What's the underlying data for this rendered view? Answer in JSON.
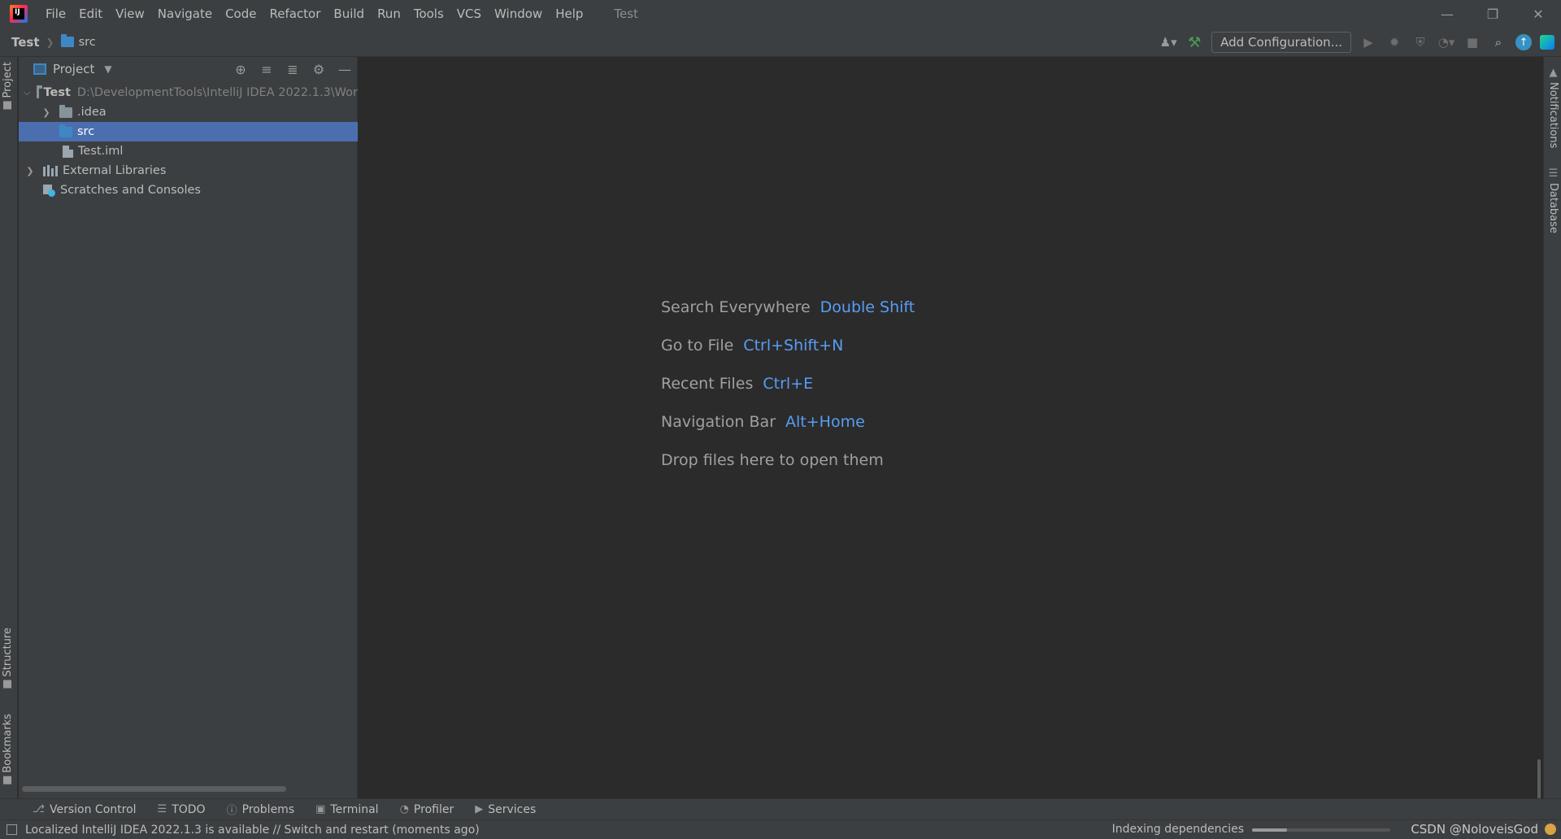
{
  "menu": {
    "items": [
      {
        "label": "File"
      },
      {
        "label": "Edit"
      },
      {
        "label": "View"
      },
      {
        "label": "Navigate"
      },
      {
        "label": "Code"
      },
      {
        "label": "Refactor"
      },
      {
        "label": "Build"
      },
      {
        "label": "Run"
      },
      {
        "label": "Tools"
      },
      {
        "label": "VCS"
      },
      {
        "label": "Window"
      },
      {
        "label": "Help"
      }
    ],
    "window_title": "Test"
  },
  "navbar": {
    "breadcrumb_root": "Test",
    "breadcrumb_folder": "src",
    "add_configuration_label": "Add Configuration..."
  },
  "project_panel": {
    "title": "Project",
    "tree": [
      {
        "label": "Test",
        "path": "D:\\DevelopmentTools\\IntelliJ IDEA 2022.1.3\\Wor",
        "expanded": true
      },
      {
        "label": ".idea"
      },
      {
        "label": "src",
        "selected": true
      },
      {
        "label": "Test.iml"
      },
      {
        "label": "External Libraries"
      },
      {
        "label": "Scratches and Consoles"
      }
    ]
  },
  "left_stripe": {
    "project_tab": "Project",
    "structure_tab": "Structure",
    "bookmarks_tab": "Bookmarks"
  },
  "right_stripe": {
    "notifications_tab": "Notifications",
    "database_tab": "Database"
  },
  "editor_hints": [
    {
      "label": "Search Everywhere",
      "key": "Double Shift"
    },
    {
      "label": "Go to File",
      "key": "Ctrl+Shift+N"
    },
    {
      "label": "Recent Files",
      "key": "Ctrl+E"
    },
    {
      "label": "Navigation Bar",
      "key": "Alt+Home"
    },
    {
      "label": "Drop files here to open them",
      "key": ""
    }
  ],
  "bottom_tabs": [
    {
      "label": "Version Control"
    },
    {
      "label": "TODO"
    },
    {
      "label": "Problems"
    },
    {
      "label": "Terminal"
    },
    {
      "label": "Profiler"
    },
    {
      "label": "Services"
    }
  ],
  "status_bar": {
    "message": "Localized IntelliJ IDEA 2022.1.3 is available // Switch and restart (moments ago)",
    "indexing_label": "Indexing dependencies",
    "indexing_progress": 0.25,
    "watermark": "CSDN @NoloveisGod"
  },
  "colors": {
    "accent_blue": "#589df6",
    "selection": "#4b6eaf",
    "panel_bg": "#3c3f41",
    "editor_bg": "#2b2b2b"
  }
}
